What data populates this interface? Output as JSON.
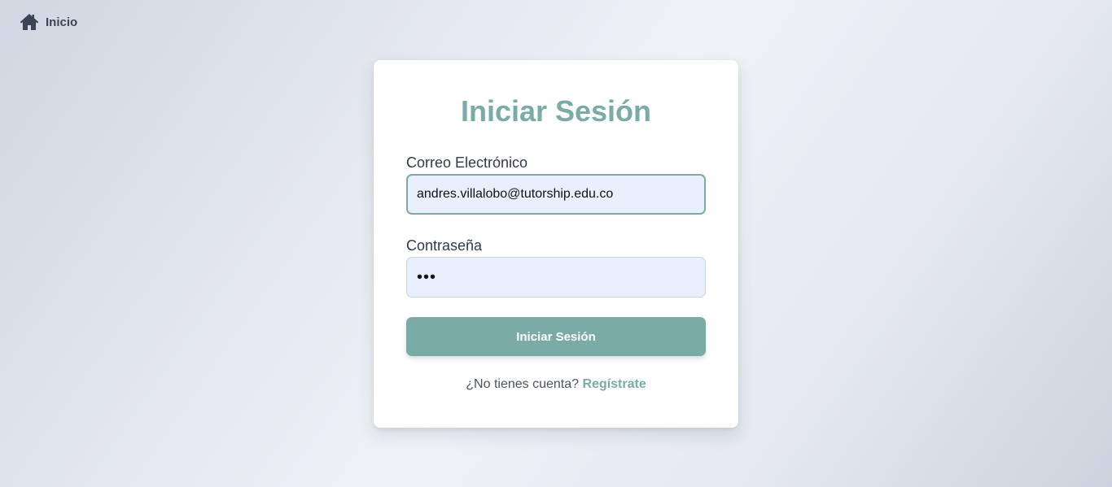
{
  "nav": {
    "home_icon": "home-icon",
    "home_label": "Inicio"
  },
  "login": {
    "title": "Iniciar Sesión",
    "email_label": "Correo Electrónico",
    "email_value": "andres.villalobo@tutorship.edu.co",
    "password_label": "Contraseña",
    "password_value": "•••",
    "submit_label": "Iniciar Sesión",
    "no_account_text": "¿No tienes cuenta?",
    "register_label": "Regístrate"
  },
  "colors": {
    "accent": "#7aaba6",
    "input_bg": "#e8f0fd",
    "text_dark": "#2f3a4a"
  }
}
